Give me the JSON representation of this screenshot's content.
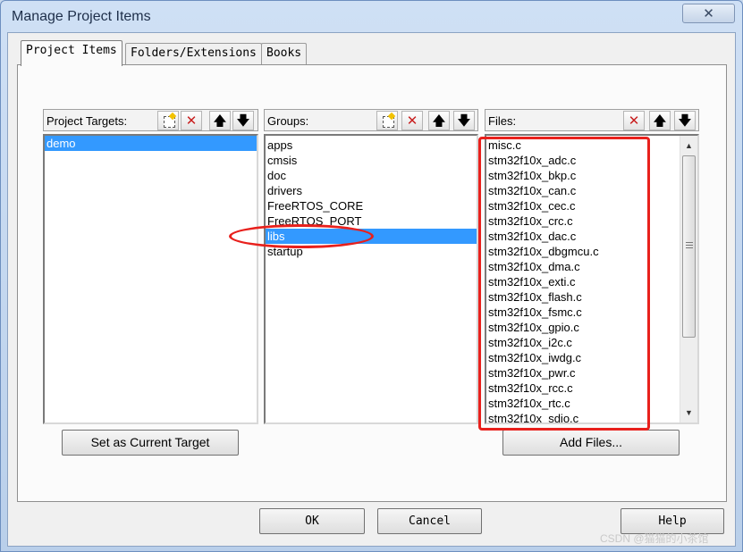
{
  "window": {
    "title": "Manage Project Items",
    "close_label": "✕"
  },
  "tabs": [
    {
      "label": "Project Items",
      "active": true
    },
    {
      "label": "Folders/Extensions",
      "active": false
    },
    {
      "label": "Books",
      "active": false
    }
  ],
  "targets": {
    "header": "Project Targets:",
    "items": [
      "demo"
    ],
    "selected": "demo"
  },
  "groups": {
    "header": "Groups:",
    "items": [
      "apps",
      "cmsis",
      "doc",
      "drivers",
      "FreeRTOS_CORE",
      "FreeRTOS_PORT",
      "libs",
      "startup"
    ],
    "selected": "libs"
  },
  "files": {
    "header": "Files:",
    "items": [
      "misc.c",
      "stm32f10x_adc.c",
      "stm32f10x_bkp.c",
      "stm32f10x_can.c",
      "stm32f10x_cec.c",
      "stm32f10x_crc.c",
      "stm32f10x_dac.c",
      "stm32f10x_dbgmcu.c",
      "stm32f10x_dma.c",
      "stm32f10x_exti.c",
      "stm32f10x_flash.c",
      "stm32f10x_fsmc.c",
      "stm32f10x_gpio.c",
      "stm32f10x_i2c.c",
      "stm32f10x_iwdg.c",
      "stm32f10x_pwr.c",
      "stm32f10x_rcc.c",
      "stm32f10x_rtc.c",
      "stm32f10x_sdio.c"
    ]
  },
  "toolbar_icons": {
    "new": "new-item-icon",
    "delete": "delete-icon",
    "up": "move-up-icon",
    "down": "move-down-icon"
  },
  "buttons": {
    "set_target": "Set as Current Target",
    "add_files": "Add Files...",
    "ok": "OK",
    "cancel": "Cancel",
    "help": "Help"
  },
  "watermark": "CSDN @猫猫的小茶馆",
  "colors": {
    "selection": "#3399ff",
    "annotation": "#e8201c"
  }
}
